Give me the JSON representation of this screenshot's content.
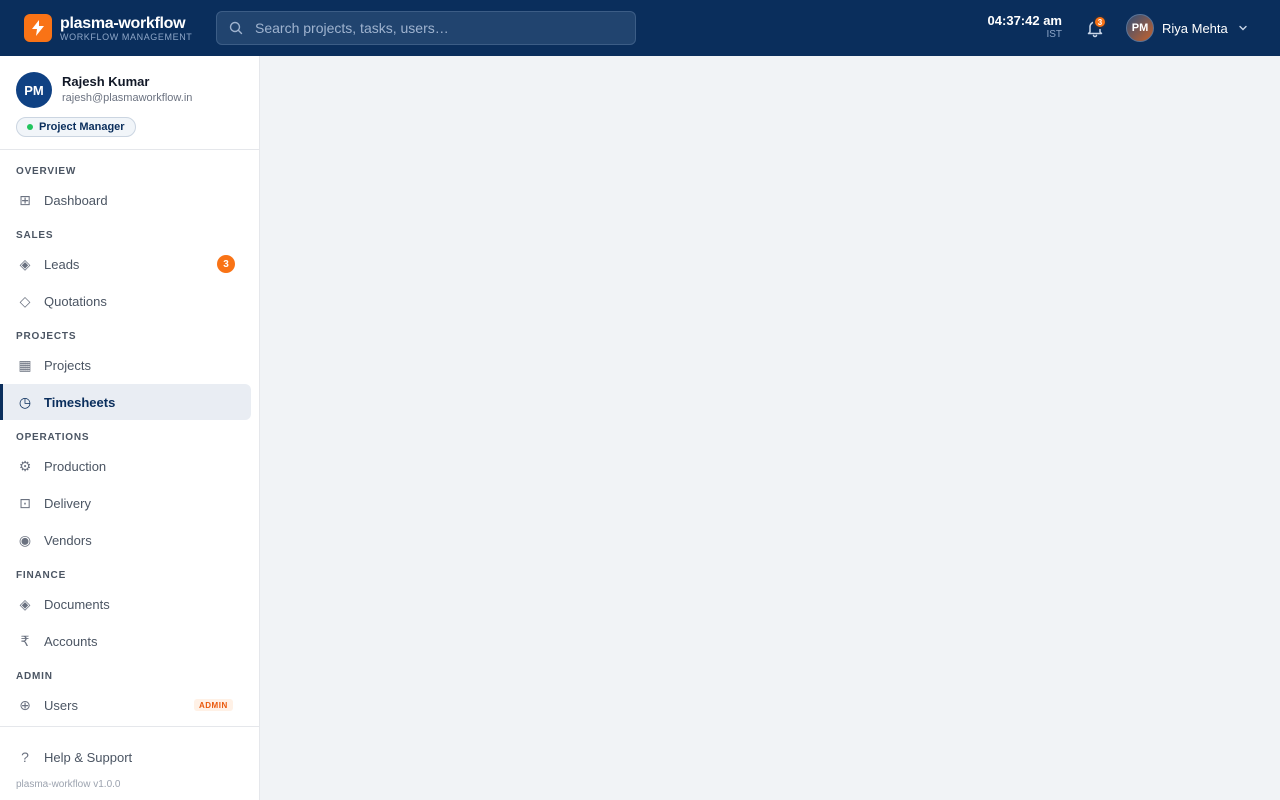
{
  "brand": {
    "name": "plasma-workflow",
    "subtitle": "WORKFLOW MANAGEMENT",
    "color": "#f97316"
  },
  "search": {
    "placeholder": "Search projects, tasks, users…"
  },
  "clock": {
    "time": "04:37:42 am",
    "timezone": "IST"
  },
  "notifications": {
    "count": "3",
    "icon": "bell-icon"
  },
  "user_menu": {
    "initials": "PM",
    "name": "Riya Mehta"
  },
  "profile": {
    "initials": "PM",
    "name": "Rajesh Kumar",
    "email": "rajesh@plasmaworkflow.in",
    "role": "Project Manager"
  },
  "sections": {
    "overview": "OVERVIEW",
    "sales": "SALES",
    "projects": "PROJECTS",
    "operations": "OPERATIONS",
    "finance": "FINANCE",
    "admin": "ADMIN"
  },
  "nav": {
    "dashboard": {
      "label": "Dashboard",
      "icon": "⊞"
    },
    "leads": {
      "label": "Leads",
      "icon": "◈",
      "badge": "3"
    },
    "quotations": {
      "label": "Quotations",
      "icon": "◇"
    },
    "projects": {
      "label": "Projects",
      "icon": "▦"
    },
    "timesheets": {
      "label": "Timesheets",
      "icon": "◷"
    },
    "production": {
      "label": "Production",
      "icon": "⚙"
    },
    "delivery": {
      "label": "Delivery",
      "icon": "⊡"
    },
    "vendors": {
      "label": "Vendors",
      "icon": "◉"
    },
    "documents": {
      "label": "Documents",
      "icon": "◈"
    },
    "accounts": {
      "label": "Accounts",
      "icon": "₹"
    },
    "users": {
      "label": "Users",
      "icon": "⊕",
      "badge": "ADMIN"
    }
  },
  "footer": {
    "help": {
      "label": "Help & Support",
      "icon": "?"
    },
    "version": "plasma-workflow v1.0.0"
  },
  "colors": {
    "header_bg": "#0a2e5c",
    "accent": "#f97316",
    "active_bg": "#e9edf3"
  }
}
